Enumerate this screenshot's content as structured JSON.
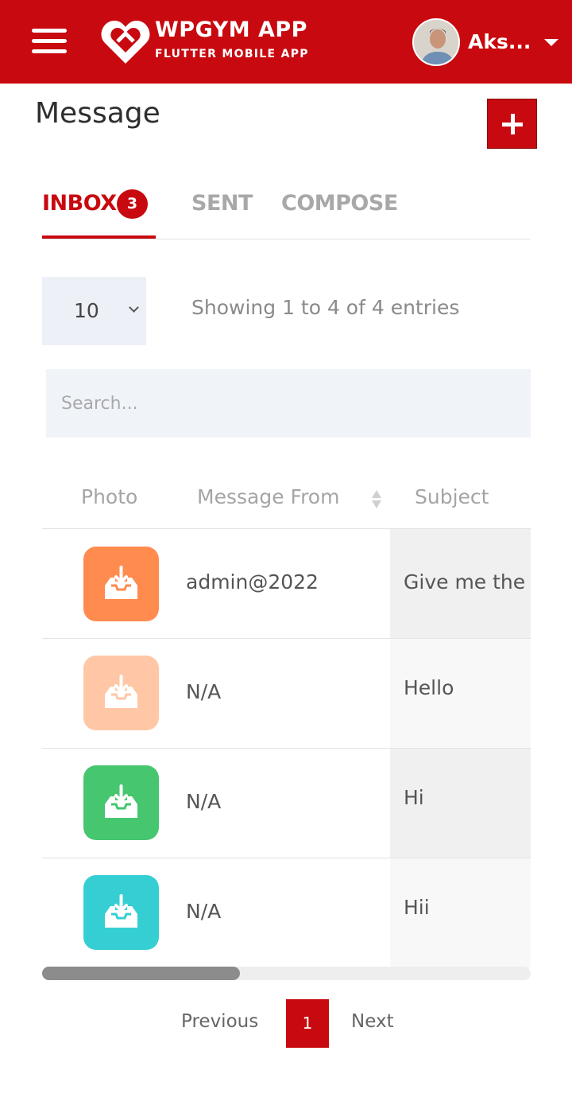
{
  "header": {
    "brand_title": "WPGYM APP",
    "brand_subtitle": "FLUTTER MOBILE APP",
    "user_name": "Aks...",
    "brand_color": "#c8090f"
  },
  "page": {
    "title": "Message"
  },
  "tabs": [
    {
      "label": "INBOX",
      "badge": "3",
      "active": true
    },
    {
      "label": "SENT",
      "active": false
    },
    {
      "label": "COMPOSE",
      "active": false
    }
  ],
  "table_controls": {
    "page_length": "10",
    "info": "Showing 1 to 4 of 4 entries",
    "search_placeholder": "Search..."
  },
  "table": {
    "columns": [
      "Photo",
      "Message From",
      "Subject"
    ],
    "rows": [
      {
        "photo_color": "#ff8b4e",
        "from": "admin@2022",
        "subject": "Give me the"
      },
      {
        "photo_color": "#ffc7a5",
        "from": "N/A",
        "subject": "Hello"
      },
      {
        "photo_color": "#46c66f",
        "from": "N/A",
        "subject": "Hi"
      },
      {
        "photo_color": "#35cfd3",
        "from": "N/A",
        "subject": "Hii"
      }
    ]
  },
  "pagination": {
    "previous": "Previous",
    "current": "1",
    "next": "Next"
  }
}
